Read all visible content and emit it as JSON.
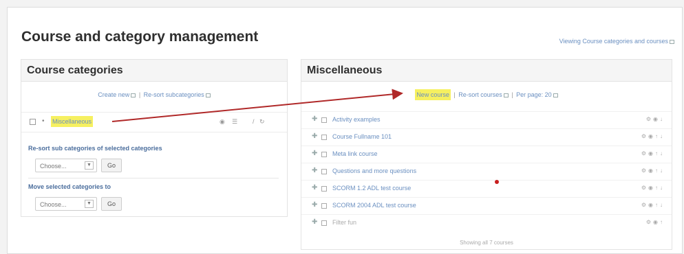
{
  "page": {
    "title": "Course and category management",
    "view_link": "Viewing Course categories and courses"
  },
  "categories_panel": {
    "heading": "Course categories",
    "create_new": "Create new",
    "resort_subcats": "Re-sort subcategories",
    "category": {
      "name": "Miscellaneous",
      "bullet": "•"
    },
    "resort_section_label": "Re-sort sub categories of selected categories",
    "move_section_label": "Move selected categories to",
    "choose_placeholder": "Choose...",
    "go_label": "Go"
  },
  "courses_panel": {
    "heading": "Miscellaneous",
    "new_course": "New course",
    "resort_courses": "Re-sort courses",
    "per_page": "Per page: 20",
    "courses": [
      {
        "name": "Activity examples"
      },
      {
        "name": "Course Fullname 101"
      },
      {
        "name": "Meta link course"
      },
      {
        "name": "Questions and more questions"
      },
      {
        "name": "SCORM 1.2 ADL test course"
      },
      {
        "name": "SCORM 2004 ADL test course"
      },
      {
        "name": "Filter fun"
      }
    ],
    "showing": "Showing all 7 courses"
  },
  "icons": {
    "move": "✚",
    "eye": "◉",
    "up": "↑",
    "down": "↓",
    "gear": "⚙",
    "settings": "☰",
    "edit": "/",
    "delete": "↻"
  },
  "colors": {
    "link": "#6a8fc0",
    "highlight": "#f6f060",
    "annotation_arrow": "#b02828"
  }
}
